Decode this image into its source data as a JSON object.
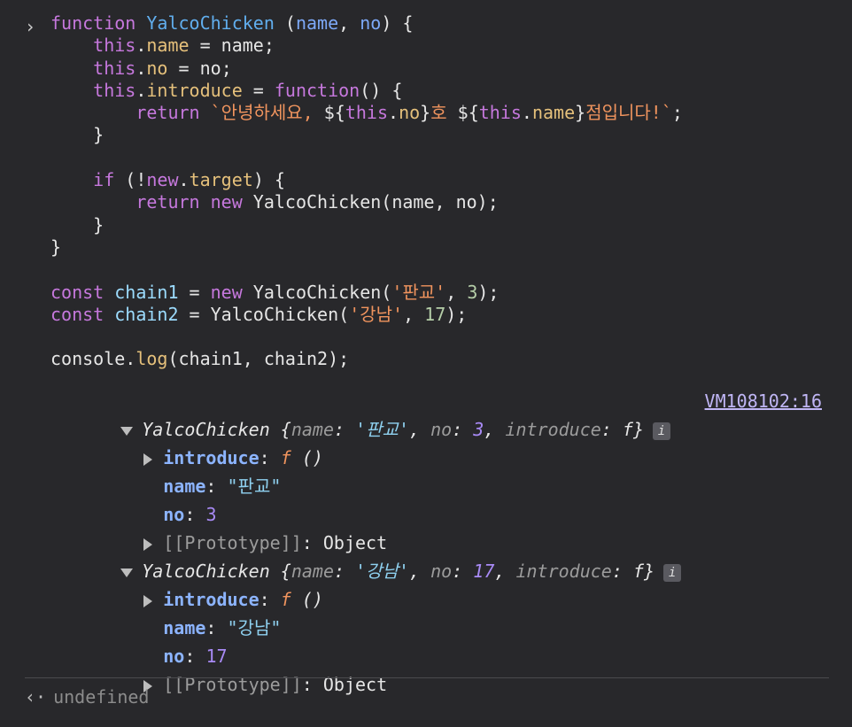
{
  "prompt_glyph": "›",
  "code": {
    "l1": {
      "kw": "function",
      "fn": "YalcoChicken",
      "p1": "(",
      "a1": "name",
      "p2": ", ",
      "a2": "no",
      "p3": ") {"
    },
    "l2": {
      "kw": "this",
      "dot": ".",
      "prop": "name",
      "rest": " = name;"
    },
    "l3": {
      "kw": "this",
      "dot": ".",
      "prop": "no",
      "rest": " = no;"
    },
    "l4": {
      "kw": "this",
      "dot": ".",
      "prop": "introduce",
      "eq": " = ",
      "kw2": "function",
      "rest": "() {"
    },
    "l5": {
      "kw": "return",
      "s1": "`안녕하세요, ",
      "i1": "${",
      "kw2": "this",
      "d1": ".",
      "p1": "no",
      "i2": "}",
      "s2": "호 ",
      "i3": "${",
      "kw3": "this",
      "d2": ".",
      "p2": "name",
      "i4": "}",
      "s3": "점입니다!`",
      "end": ";"
    },
    "l6": "}",
    "l8": {
      "kw": "if",
      "p1": " (!",
      "kw2": "new",
      "d": ".",
      "prop": "target",
      "rest": ") {"
    },
    "l9": {
      "kw": "return",
      "kw2": "new",
      "rest": " YalcoChicken(name, no);"
    },
    "l10": "}",
    "l11": "}",
    "l13": {
      "kw": "const",
      "v": "chain1",
      "eq": " = ",
      "kw2": "new",
      "fn": " YalcoChicken(",
      "s": "'판교'",
      "c": ", ",
      "n": "3",
      "end": ");"
    },
    "l14": {
      "kw": "const",
      "v": "chain2",
      "eq": " = ",
      "fn": "YalcoChicken(",
      "s": "'강남'",
      "c": ", ",
      "n": "17",
      "end": ");"
    },
    "l16": {
      "obj": "console",
      "d": ".",
      "fn": "log",
      "rest": "(chain1, chain2);"
    }
  },
  "output": {
    "source_link": "VM108102:16",
    "objects": [
      {
        "class_name": "YalcoChicken",
        "k_name": "name",
        "v_name": "'판교'",
        "k_no": "no",
        "v_no": "3",
        "k_intro": "introduce",
        "v_intro": "f",
        "intro_label": "introduce",
        "intro_f": "f",
        "intro_parens": "()",
        "name_label": "name",
        "name_value": "\"판교\"",
        "no_label": "no",
        "no_value": "3",
        "proto_label": "[[Prototype]]",
        "proto_value": "Object"
      },
      {
        "class_name": "YalcoChicken",
        "k_name": "name",
        "v_name": "'강남'",
        "k_no": "no",
        "v_no": "17",
        "k_intro": "introduce",
        "v_intro": "f",
        "intro_label": "introduce",
        "intro_f": "f",
        "intro_parens": "()",
        "name_label": "name",
        "name_value": "\"강남\"",
        "no_label": "no",
        "no_value": "17",
        "proto_label": "[[Prototype]]",
        "proto_value": "Object"
      }
    ],
    "info_icon": "i"
  },
  "result": {
    "arrow": "‹·",
    "text": "undefined"
  }
}
